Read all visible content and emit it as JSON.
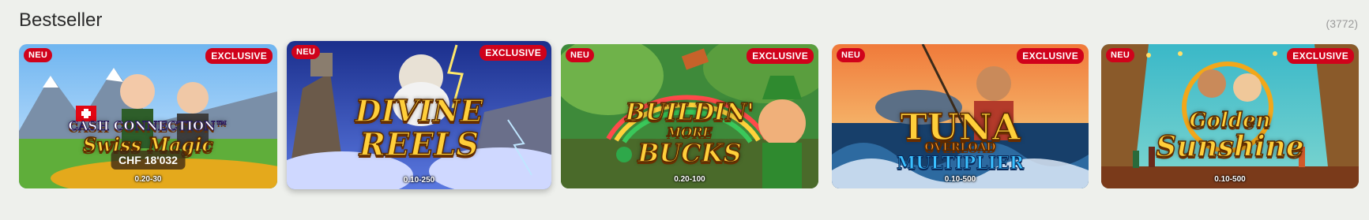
{
  "section": {
    "title": "Bestseller",
    "count": "(3772)"
  },
  "badges": {
    "new": "NEU",
    "exclusive": "EXCLUSIVE"
  },
  "games": [
    {
      "title_line1": "CASH CONNECTION™",
      "title_line2": "Swiss Magic",
      "jackpot": "CHF 18'032",
      "stake": "0.20-30"
    },
    {
      "title_line1": "DIVINE",
      "title_line2": "REELS",
      "stake": "0.10-250"
    },
    {
      "title_line1": "BUILDIN'",
      "title_line2": "MORE",
      "title_line3": "BUCKS",
      "stake": "0.20-100"
    },
    {
      "title_line1": "TUNA",
      "title_line2": "OVERLOAD",
      "title_line3": "MULTIPLIER",
      "stake": "0.10-500"
    },
    {
      "title_line1": "Golden",
      "title_line2": "Sunshine",
      "stake": "0.10-500"
    }
  ]
}
